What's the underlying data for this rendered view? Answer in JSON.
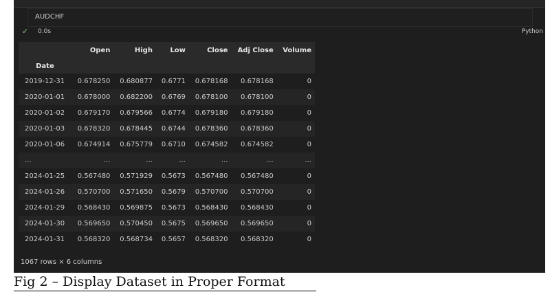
{
  "cell": {
    "code": "AUDCHF",
    "status_icon": "check-icon",
    "exec_time": "0.0s",
    "language": "Python"
  },
  "table": {
    "columns": [
      "Open",
      "High",
      "Low",
      "Close",
      "Adj Close",
      "Volume"
    ],
    "index_name": "Date",
    "rows": [
      [
        "2019-12-31",
        "0.678250",
        "0.680877",
        "0.6771",
        "0.678168",
        "0.678168",
        "0"
      ],
      [
        "2020-01-01",
        "0.678000",
        "0.682200",
        "0.6769",
        "0.678100",
        "0.678100",
        "0"
      ],
      [
        "2020-01-02",
        "0.679170",
        "0.679566",
        "0.6774",
        "0.679180",
        "0.679180",
        "0"
      ],
      [
        "2020-01-03",
        "0.678320",
        "0.678445",
        "0.6744",
        "0.678360",
        "0.678360",
        "0"
      ],
      [
        "2020-01-06",
        "0.674914",
        "0.675779",
        "0.6710",
        "0.674582",
        "0.674582",
        "0"
      ],
      [
        "...",
        "...",
        "...",
        "...",
        "...",
        "...",
        "..."
      ],
      [
        "2024-01-25",
        "0.567480",
        "0.571929",
        "0.5673",
        "0.567480",
        "0.567480",
        "0"
      ],
      [
        "2024-01-26",
        "0.570700",
        "0.571650",
        "0.5679",
        "0.570700",
        "0.570700",
        "0"
      ],
      [
        "2024-01-29",
        "0.568430",
        "0.569875",
        "0.5673",
        "0.568430",
        "0.568430",
        "0"
      ],
      [
        "2024-01-30",
        "0.569650",
        "0.570450",
        "0.5675",
        "0.569650",
        "0.569650",
        "0"
      ],
      [
        "2024-01-31",
        "0.568320",
        "0.568734",
        "0.5657",
        "0.568320",
        "0.568320",
        "0"
      ]
    ],
    "shape": "1067 rows × 6 columns"
  },
  "caption": "Fig 2 – Display Dataset in Proper Format"
}
